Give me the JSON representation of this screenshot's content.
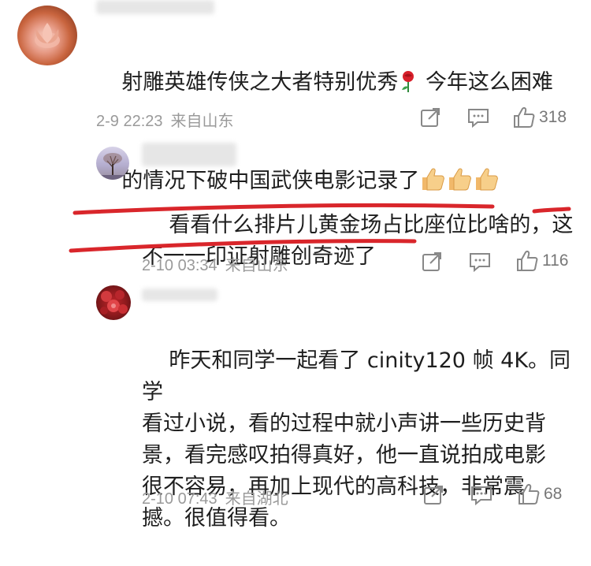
{
  "comments": [
    {
      "text_parts": [
        "射雕英雄传侠之大者特别优秀",
        "今年这么困难",
        "的情况下破中国武侠电影记录了"
      ],
      "time": "2-9 22:23",
      "location": "来自山东",
      "likes": "318",
      "avatar_icon": "lotus-avatar-icon",
      "emojis": [
        "rose-emoji",
        "thumbs-up-emoji",
        "thumbs-up-emoji",
        "thumbs-up-emoji"
      ]
    },
    {
      "text_lines": [
        "看看什么排片儿黄金场占比座位比啥的，这",
        "不一一印证射雕创奇迹了"
      ],
      "time": "2-10 03:34",
      "location": "来自山东",
      "likes": "116",
      "avatar_icon": "tree-avatar-icon",
      "underline_color": "#d9262b"
    },
    {
      "text_lines": [
        "昨天和同学一起看了 cinity120 帧 4K。同学",
        "看过小说，看的过程中就小声讲一些历史背",
        "景，看完感叹拍得真好，他一直说拍成电影",
        "很不容易，再加上现代的高科技，非常震",
        "撼。很值得看。"
      ],
      "time": "2-10 07:43",
      "location": "来自湖北",
      "likes": "68",
      "avatar_icon": "red-flowers-avatar-icon"
    }
  ],
  "icons": {
    "share": "share-icon",
    "reply": "comment-icon",
    "like": "thumbs-up-icon"
  },
  "colors": {
    "text": "#1e1e1e",
    "meta": "#9a9a9a",
    "underline": "#d9262b"
  }
}
